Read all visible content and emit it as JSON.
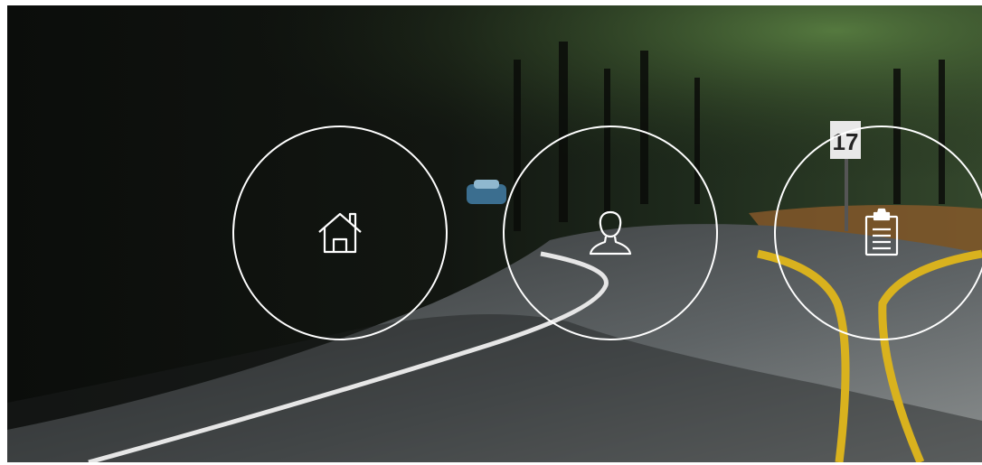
{
  "nav": {
    "items": [
      {
        "id": "home",
        "icon": "home-icon"
      },
      {
        "id": "profile",
        "icon": "user-icon"
      },
      {
        "id": "clipboard",
        "icon": "clipboard-icon"
      }
    ]
  },
  "sign": {
    "text": "17"
  },
  "colors": {
    "circle_stroke": "#ffffff",
    "icon_stroke": "#ffffff",
    "road_center_line": "#d9b21e",
    "road_edge_line": "#e6e6e6"
  }
}
